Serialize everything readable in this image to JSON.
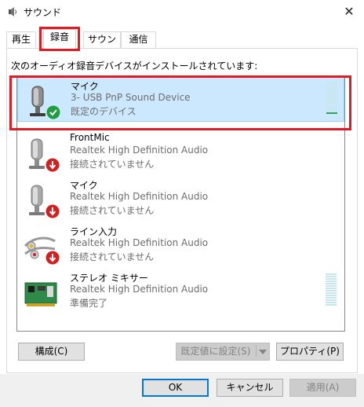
{
  "window": {
    "title": "サウンド",
    "close_glyph": "✕"
  },
  "tabs": [
    {
      "label": "再生"
    },
    {
      "label": "録音",
      "active": true
    },
    {
      "label": "サウンド"
    },
    {
      "label": "通信"
    }
  ],
  "instruction": "次のオーディオ録音デバイスがインストールされています:",
  "devices": [
    {
      "name": "マイク",
      "sub": "3- USB PnP Sound Device",
      "status": "既定のデバイス",
      "icon": "microphone-icon",
      "badge": "default-check-icon",
      "selected": true,
      "level": 0.2
    },
    {
      "name": "FrontMic",
      "sub": "Realtek High Definition Audio",
      "status": "接続されていません",
      "icon": "microphone-icon",
      "badge": "disconnected-arrow-icon"
    },
    {
      "name": "マイク",
      "sub": "Realtek High Definition Audio",
      "status": "接続されていません",
      "icon": "microphone-icon",
      "badge": "disconnected-arrow-icon"
    },
    {
      "name": "ライン入力",
      "sub": "Realtek High Definition Audio",
      "status": "接続されていません",
      "icon": "line-in-cable-icon",
      "badge": "disconnected-arrow-icon"
    },
    {
      "name": "ステレオ ミキサー",
      "sub": "Realtek High Definition Audio",
      "status": "準備完了",
      "icon": "sound-card-icon",
      "level": 0.0
    }
  ],
  "buttons": {
    "configure": "構成(C)",
    "set_default": "既定値に設定(S)",
    "properties": "プロパティ(P)",
    "ok": "OK",
    "cancel": "キャンセル",
    "apply": "適用(A)"
  },
  "colors": {
    "highlight_box": "#e01b24",
    "selection_bg": "#cce8ff",
    "meter_level": "#2ea44f"
  }
}
